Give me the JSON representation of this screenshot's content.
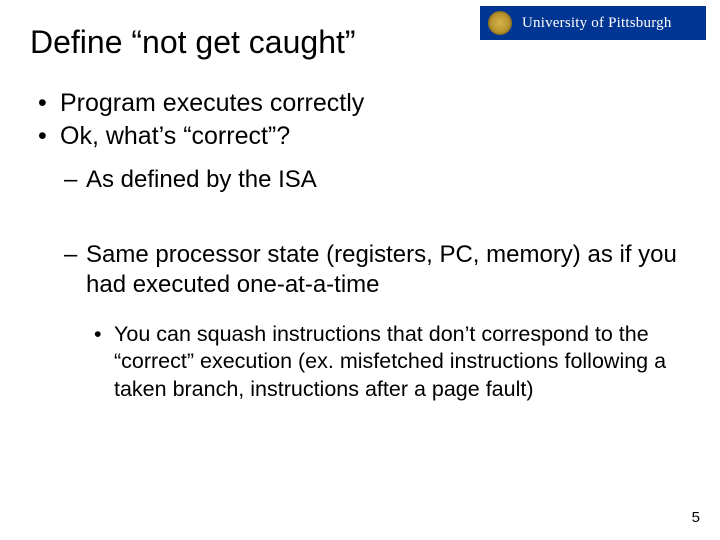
{
  "logo": {
    "text": "University of Pittsburgh"
  },
  "title": "Define “not get caught”",
  "bullets": {
    "l1a": "Program executes correctly",
    "l1b": "Ok, what’s “correct”?",
    "l2a": "As defined by the ISA",
    "l2b": "Same processor state (registers, PC, memory) as if you had executed one-at-a-time",
    "l3a": "You can squash instructions that don’t correspond to the “correct” execution (ex. misfetched instructions following a taken branch, instructions after a page fault)"
  },
  "page_number": "5"
}
